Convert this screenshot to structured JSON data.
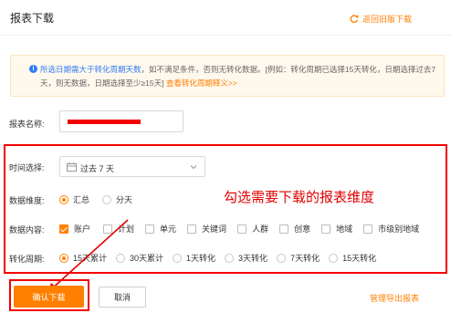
{
  "header": {
    "title": "报表下载",
    "back_link": "返回旧版下载"
  },
  "notice": {
    "prefix": "所选日期需大于转化周期天数",
    "body": "，如不满足条件，否则无转化数据。[例如：转化周期已选择15天转化，日期选择过去7天，则无数据，日期选择至少≥15天]",
    "link": "查看转化周期释义>>"
  },
  "form": {
    "name_label": "报表名称:",
    "time_label": "时间选择:",
    "time_value": "过去 7 天",
    "dimension_label": "数据维度:",
    "dimension_options": [
      "汇总",
      "分天"
    ],
    "content_label": "数据内容:",
    "content_options": [
      "账户",
      "计划",
      "单元",
      "关键词",
      "人群",
      "创意",
      "地域",
      "市级别地域"
    ],
    "cycle_label": "转化周期:",
    "cycle_options": [
      "15天累计",
      "30天累计",
      "1天转化",
      "3天转化",
      "7天转化",
      "15天转化"
    ]
  },
  "annotation": "勾选需要下载的报表维度",
  "footer": {
    "confirm": "确认下载",
    "cancel": "取消",
    "manage": "管理导出报表"
  },
  "colors": {
    "accent": "#ff7f00",
    "highlight_red": "#f20000",
    "link_blue": "#2f7df6"
  }
}
